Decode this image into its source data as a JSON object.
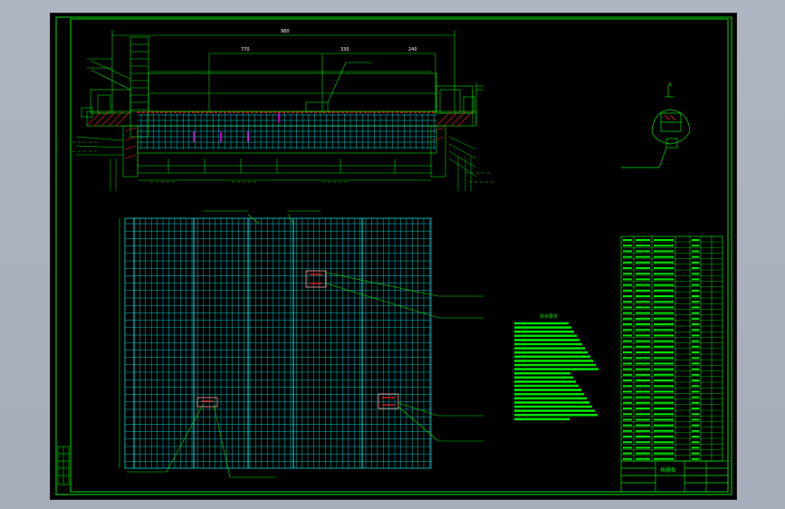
{
  "drawing": {
    "background": "#000000",
    "viewport_bg": "#a9b0bd",
    "line_color": "#00e000",
    "grid_color": "#00d8d8",
    "accent_red": "#ff2020",
    "accent_magenta": "#ff00ff",
    "dimension_color": "#ffffff"
  },
  "title_block": {
    "name": "格栅板"
  },
  "labels": {
    "notes_heading": "技术要求",
    "section_mark": "A"
  }
}
